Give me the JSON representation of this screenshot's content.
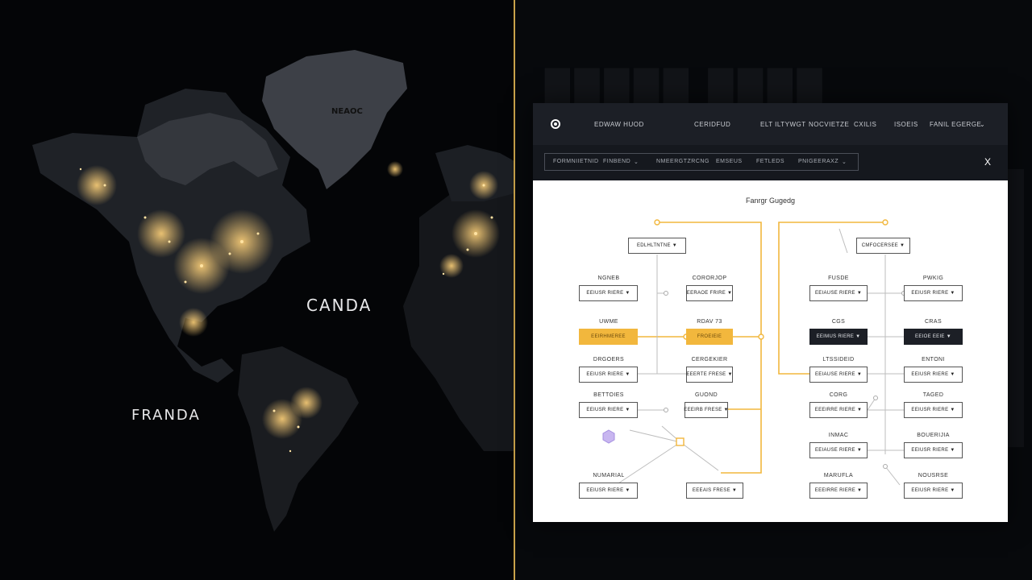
{
  "map": {
    "labels": {
      "greenland": "NEAOC",
      "canada": "CANDA",
      "south": "FRANDA"
    }
  },
  "window": {
    "nav": [
      "EDWAW HUOD",
      "CERIDFUD",
      "ELT ILTYWGT",
      "NOCVIETZE",
      "CXILIS",
      "ISOEIS",
      "FANIL EGERGE"
    ],
    "filters": [
      "FORMNIIETNID",
      "FINBEND",
      "NMEERGTZRCNG",
      "EMSEUS",
      "FETLEDS",
      "PNIGEERAXZ"
    ],
    "close": "X",
    "title": "Fanrgr Gugedg",
    "nodes": {
      "top_left": "EDLHLTNTNE",
      "top_right": "CMFOCERSEE",
      "r1_a_label": "NGNEB",
      "r1_a": "EEIUSR RIERE",
      "r1_b_label": "CORORJOP",
      "r1_b": "EERAOE FRIRE",
      "r2_a_label": "UWME",
      "r2_a": "EEIRHMEREE",
      "r2_b_label": "RDAV 73",
      "r2_b": "FROEIEIE",
      "r3_a_label": "DRGOERS",
      "r3_a": "EEIUSR RIERE",
      "r3_b_label": "CERGEKIER",
      "r3_b": "EEERTE FRESE",
      "r4_a_label": "BETTOIES",
      "r4_a": "EEIUSR RIERE",
      "r4_b_label": "GUOND",
      "r4_b": "EEEIRB FRESE",
      "r5_a_label": "NUMARIAL",
      "r5_a": "EEIUSR RIERE",
      "r5_b": "EEEAIS FRESE",
      "q1_a_label": "FUSDE",
      "q1_a": "EEIAUSE RIERE",
      "q1_b_label": "PWKIG",
      "q1_b": "EEIUSR RIERE",
      "q2_a_label": "CGS",
      "q2_a": "EEIMUS RIERE",
      "q2_b_label": "CRAS",
      "q2_b": "EEIOE EEIE",
      "q3_a_label": "LTSSIDEID",
      "q3_a": "EEIAUSE RIERE",
      "q3_b_label": "ENTONI",
      "q3_b": "EEIUSR RIERE",
      "q4_a_label": "CORG",
      "q4_a": "EEEIRRE RIERE",
      "q4_b_label": "TAGED",
      "q4_b": "EEIUSR RIERE",
      "q5_a_label": "INMAC",
      "q5_a": "EEIAUSE RIERE",
      "q5_b_label": "BOUERIJIA",
      "q5_b": "EEIUSR RIERE",
      "q6_a_label": "MARUFLA",
      "q6_a": "EEEIRRE RIERE",
      "q6_b_label": "NOUSRSE",
      "q6_b": "EEIUSR RIERE"
    }
  },
  "colors": {
    "accent": "#f2b73d",
    "topbar": "#1c1f26",
    "divider": "#c9a24a"
  }
}
